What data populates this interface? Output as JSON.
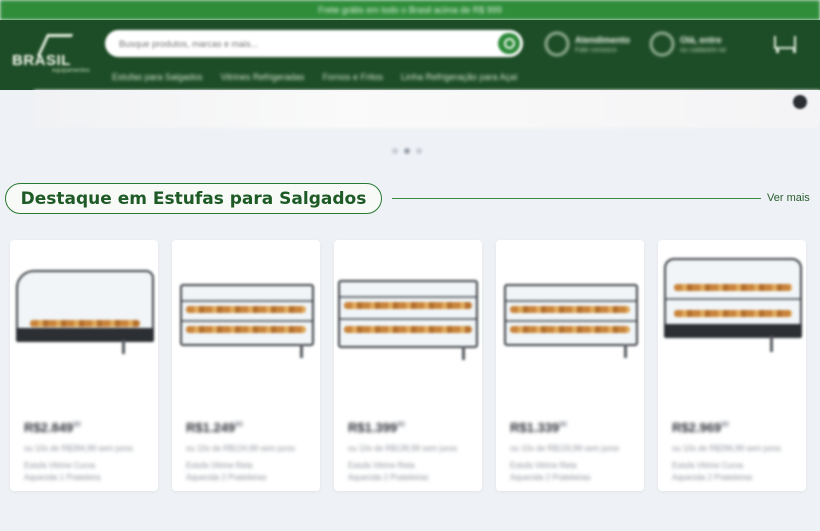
{
  "promo": {
    "text": "Frete grátis em todo o Brasil acima de R$ 999"
  },
  "header": {
    "logo": {
      "word": "BRASIL",
      "sub": "equipamentos"
    },
    "search": {
      "placeholder": "Busque produtos, marcas e mais..."
    },
    "contact": {
      "title": "Atendimento",
      "subtitle": "Fale conosco"
    },
    "account": {
      "title": "Olá, entre",
      "subtitle": "ou cadastre-se"
    },
    "nav": [
      "Estufas para Salgados",
      "Vitrines Refrigeradas",
      "Fornos e Fritos",
      "Linha Refrigeração para Açaí"
    ]
  },
  "section": {
    "title": "Destaque em Estufas para Salgados",
    "see_more": "Ver mais"
  },
  "products": [
    {
      "price": "R$2.849",
      "cents": "90",
      "line1": "ou 10x de R$284,99 sem juros",
      "line2": "Estufa Vitrine Curva",
      "line3": "Aquecida 1 Prateleira"
    },
    {
      "price": "R$1.249",
      "cents": "90",
      "line1": "ou 10x de R$124,99 sem juros",
      "line2": "Estufa Vitrine Reta",
      "line3": "Aquecida 2 Prateleiras"
    },
    {
      "price": "R$1.399",
      "cents": "90",
      "line1": "ou 10x de R$139,99 sem juros",
      "line2": "Estufa Vitrine Reta",
      "line3": "Aquecida 2 Prateleiras"
    },
    {
      "price": "R$1.339",
      "cents": "90",
      "line1": "ou 10x de R$133,99 sem juros",
      "line2": "Estufa Vitrine Reta",
      "line3": "Aquecida 2 Prateleiras"
    },
    {
      "price": "R$2.969",
      "cents": "90",
      "line1": "ou 10x de R$296,99 sem juros",
      "line2": "Estufa Vitrine Curva",
      "line3": "Aquecida 2 Prateleiras"
    }
  ],
  "colors": {
    "header": "#1d4d26",
    "promo": "#2f8d3a",
    "accent": "#2a7a34",
    "page_bg": "#eef1f5"
  }
}
